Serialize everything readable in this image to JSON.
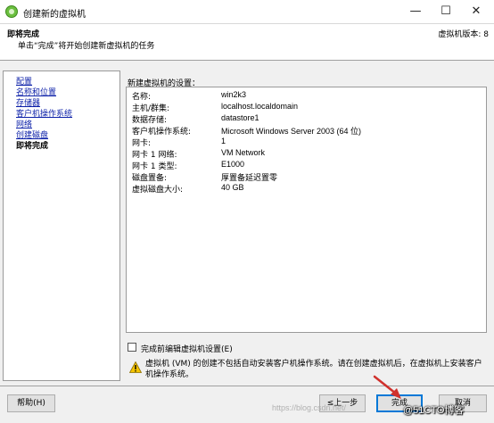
{
  "window": {
    "title": "创建新的虚拟机",
    "minimize_glyph": "—",
    "maximize_glyph": "☐",
    "close_glyph": "✕"
  },
  "header": {
    "title": "即将完成",
    "subtitle": "单击“完成”将开始创建新虚拟机的任务",
    "version": "虚拟机版本: 8"
  },
  "nav": {
    "items": [
      {
        "label": "配置",
        "current": false
      },
      {
        "label": "名称和位置",
        "current": false
      },
      {
        "label": "存储器",
        "current": false
      },
      {
        "label": "客户机操作系统",
        "current": false
      },
      {
        "label": "网络",
        "current": false
      },
      {
        "label": "创建磁盘",
        "current": false
      },
      {
        "label": "即将完成",
        "current": true
      }
    ]
  },
  "settings": {
    "label": "新建虚拟机的设置：",
    "rows": [
      {
        "key": "名称:",
        "value": "win2k3"
      },
      {
        "key": "主机/群集:",
        "value": "localhost.localdomain"
      },
      {
        "key": "数据存储:",
        "value": "datastore1"
      },
      {
        "key": "客户机操作系统:",
        "value": "Microsoft Windows Server 2003 (64 位)"
      },
      {
        "key": "网卡:",
        "value": "1"
      },
      {
        "key": "网卡 1 网络:",
        "value": "VM Network"
      },
      {
        "key": "网卡 1 类型:",
        "value": "E1000"
      },
      {
        "key": "磁盘置备:",
        "value": "厚置备延迟置零"
      },
      {
        "key": "虚拟磁盘大小:",
        "value": "40 GB"
      }
    ]
  },
  "edit_before_finish": {
    "label": "完成前编辑虚拟机设置(E)",
    "checked": false
  },
  "warning": {
    "icon": "warning-triangle-icon",
    "text": "虚拟机 (VM) 的创建不包括自动安装客户机操作系统。请在创建虚拟机后，在虚拟机上安装客户机操作系统。"
  },
  "buttons": {
    "help": "帮助(H)",
    "back": "≤上一步",
    "finish": "完成",
    "cancel": "取消"
  },
  "watermark": "https://blog.csdn.net/",
  "brand": "@51CTO博客",
  "colors": {
    "link": "#0b1fa8",
    "warning": "#f5c400",
    "arrow": "#d0312d",
    "default_button_border": "#0078d7"
  }
}
